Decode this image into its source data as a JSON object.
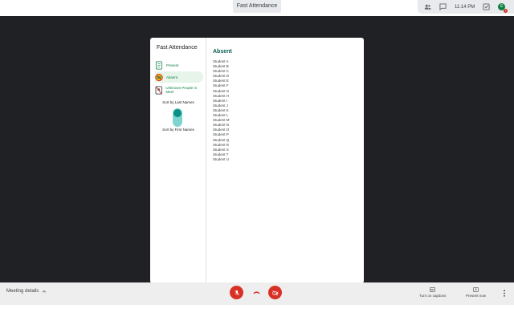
{
  "meet": {
    "topbar_title": "Fast Attendance",
    "time": "11:14 PM",
    "avatar_initial": "E",
    "avatar_badge": "1"
  },
  "dialog": {
    "title": "Fast Attendance",
    "nav": [
      {
        "label": "Present",
        "icon": "clipboard-icon",
        "active": false
      },
      {
        "label": "Absent",
        "icon": "no-entry-icon",
        "active": true
      },
      {
        "label": "Unknown People in Meet",
        "icon": "unknown-person-icon",
        "active": false
      }
    ],
    "sort_last": "Sort by Last Names",
    "sort_first": "Sort by First Names",
    "section_title": "Absent",
    "students": [
      "Student A",
      "Student B",
      "Student C",
      "Student D",
      "Student E",
      "Student F",
      "Student G",
      "Student H",
      "Student I",
      "Student J",
      "Student K",
      "Student L",
      "Student M",
      "Student N",
      "Student O",
      "Student P",
      "Student Q",
      "Student R",
      "Student S",
      "Student T",
      "Student U"
    ]
  },
  "bottombar": {
    "meeting_details": "Meeting details",
    "captions": "Turn on captions",
    "present": "Present now"
  },
  "colors": {
    "accent": "#0b8043",
    "toggle_track": "#80d4d0",
    "toggle_knob": "#0b8f87",
    "danger": "#d93025",
    "stage": "#202124"
  }
}
